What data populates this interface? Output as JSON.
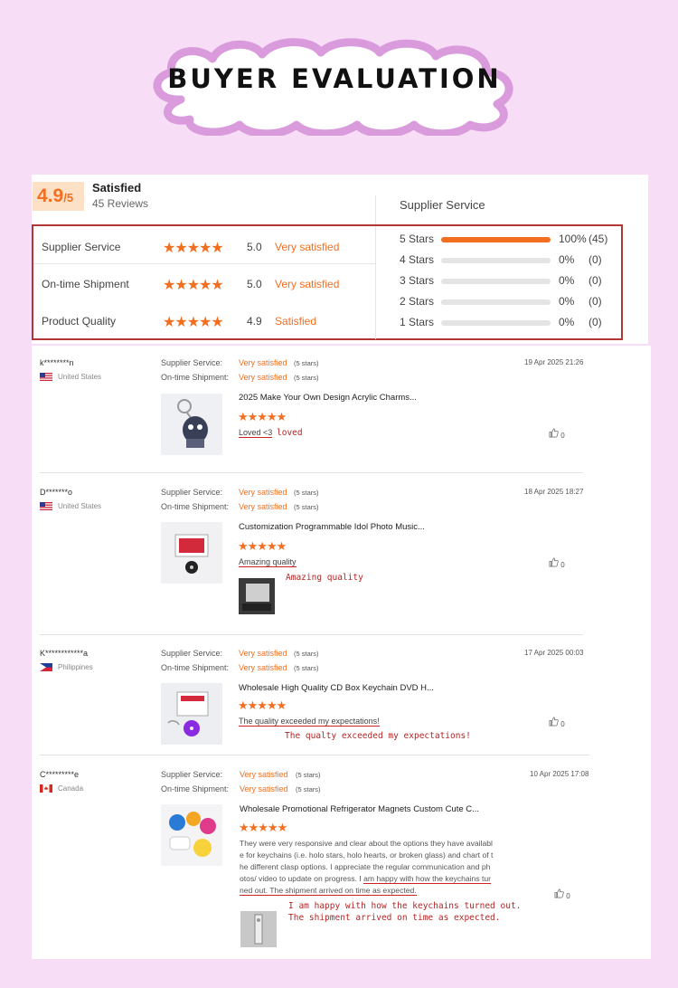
{
  "banner": {
    "title": "BUYER EVALUATION"
  },
  "summary": {
    "score": "4.9",
    "score_suffix": "/5",
    "status": "Satisfied",
    "reviews": "45 Reviews",
    "supplier_service_heading": "Supplier Service",
    "ratings": [
      {
        "label": "Supplier Service",
        "stars": "★★★★★",
        "score": "5.0",
        "text": "Very satisfied"
      },
      {
        "label": "On-time Shipment",
        "stars": "★★★★★",
        "score": "5.0",
        "text": "Very satisfied"
      },
      {
        "label": "Product Quality",
        "stars": "★★★★★",
        "score": "4.9",
        "text": "Satisfied"
      }
    ],
    "distribution": [
      {
        "label": "5 Stars",
        "percent": "100%",
        "count": "(45)",
        "fill": 1.0
      },
      {
        "label": "4 Stars",
        "percent": "0%",
        "count": "(0)",
        "fill": 0
      },
      {
        "label": "3 Stars",
        "percent": "0%",
        "count": "(0)",
        "fill": 0
      },
      {
        "label": "2 Stars",
        "percent": "0%",
        "count": "(0)",
        "fill": 0
      },
      {
        "label": "1 Stars",
        "percent": "0%",
        "count": "(0)",
        "fill": 0
      }
    ]
  },
  "review_labels": {
    "supplier_service": "Supplier Service:",
    "ontime_shipment": "On-time Shipment:"
  },
  "reviews": [
    {
      "user": "k********n",
      "country": "United States",
      "flag": "us",
      "service": "Very satisfied",
      "service_stars": "(5 stars)",
      "shipment": "Very satisfied",
      "shipment_stars": "(5 stars)",
      "date": "19 Apr 2025 21:26",
      "product": "2025 Make Your Own Design Acrylic Charms...",
      "stars": "★★★★★",
      "comment": "Loved <3",
      "annotation": "loved",
      "likes": "0"
    },
    {
      "user": "D*******o",
      "country": "United States",
      "flag": "us",
      "service": "Very satisfied",
      "service_stars": "(5 stars)",
      "shipment": "Very satisfied",
      "shipment_stars": "(5 stars)",
      "date": "18 Apr 2025 18:27",
      "product": "Customization Programmable Idol Photo Music...",
      "stars": "★★★★★",
      "comment": "Amazing quality",
      "annotation": "Amazing quality",
      "likes": "0"
    },
    {
      "user": "K************a",
      "country": "Philippines",
      "flag": "ph",
      "service": "Very satisfied",
      "service_stars": "(5 stars)",
      "shipment": "Very satisfied",
      "shipment_stars": "(5 stars)",
      "date": "17 Apr 2025 00:03",
      "product": "Wholesale High Quality CD Box Keychain DVD H...",
      "stars": "★★★★★",
      "comment": "The quality exceeded my expectations!",
      "annotation": "The qualty exceeded my expectations!",
      "likes": "0"
    },
    {
      "user": "C*********e",
      "country": "Canada",
      "flag": "ca",
      "service": "Very satisfied",
      "service_stars": "(5 stars)",
      "shipment": "Very satisfied",
      "shipment_stars": "(5 stars)",
      "date": "10 Apr 2025 17:08",
      "product": "Wholesale Promotional Refrigerator Magnets Custom Cute C...",
      "stars": "★★★★★",
      "comment_lines": [
        "They were very responsive and clear about the options they have availabl",
        "e for keychains (i.e. holo stars, holo hearts, or broken glass) and chart of t",
        "he different clasp options. I appreciate the regular communication and ph",
        "otos/ video to update on progress. I "
      ],
      "comment_ul_1": "am happy with how the keychains tur",
      "comment_ul_2": "ned out. The shipment arrived on time as expected.",
      "annotation_1": "I am happy with how the keychains turned out.",
      "annotation_2": "The shipment arrived on time as expected.",
      "likes": "0"
    }
  ],
  "colors": {
    "accent": "#f26f21",
    "frame": "#b33636",
    "background": "#f7ddf6",
    "annotation": "#b32525"
  },
  "icons": {
    "like": "thumbs-up-icon"
  }
}
